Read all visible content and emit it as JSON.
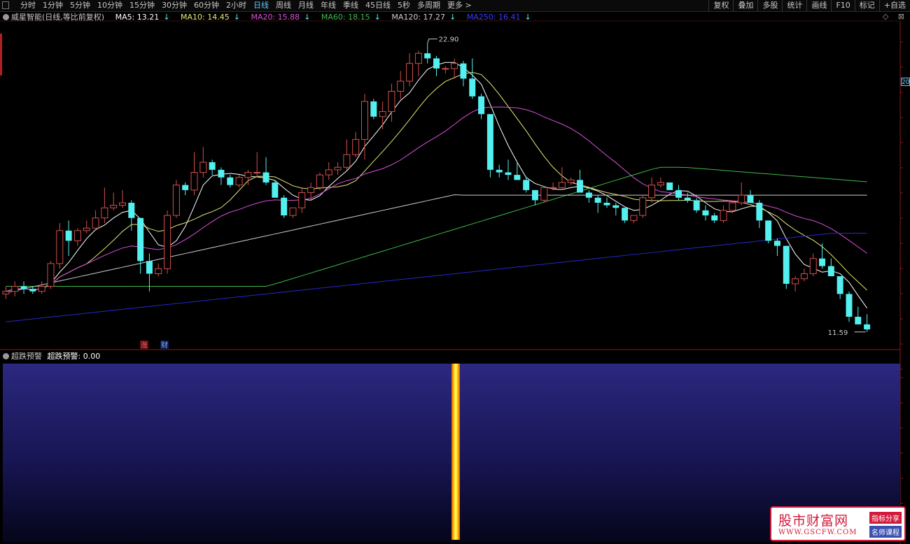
{
  "toolbar": {
    "periods": [
      "分时",
      "1分钟",
      "5分钟",
      "10分钟",
      "15分钟",
      "30分钟",
      "60分钟",
      "2小时",
      "日线",
      "周线",
      "月线",
      "年线",
      "季线",
      "45日线",
      "5秒",
      "多周期",
      "更多 >"
    ],
    "active_index": 8,
    "right_tools": [
      "复权",
      "叠加",
      "多股",
      "统计",
      "画线",
      "F10",
      "标记",
      "+自选"
    ]
  },
  "legend": {
    "stock": "威星智能(日线,等比前复权)",
    "ma5": "MA5: 13.21",
    "ma10": "MA10: 14.45",
    "ma20": "MA20: 15.88",
    "ma60": "MA60: 18.15",
    "ma120": "MA120: 17.27",
    "ma250": "MA250: 16.41",
    "arrow": "↓"
  },
  "tr_icons": [
    "diamond-icon",
    "close-icon"
  ],
  "axis_tag": "20",
  "chart": {
    "high_label": "22.90",
    "low_label": "11.59",
    "markers": [
      "涨",
      "财"
    ]
  },
  "sub": {
    "title": "超跌预警",
    "value": "超跌预警: 0.00"
  },
  "watermark": {
    "name": "股市财富网",
    "url": "WWW.GSCFW.COM",
    "tag1": "指标分享",
    "tag2": "名师课程"
  },
  "colors": {
    "up": "#d2504b",
    "down": "#54f0f0",
    "ma5": "#ffffff",
    "ma10": "#e6e675",
    "ma20": "#d94fd9",
    "ma60": "#3fb84a",
    "ma120": "#cccccc",
    "ma250": "#2727c8"
  },
  "chart_data": {
    "type": "candlestick",
    "price_range": [
      11.3,
      23.5
    ],
    "candles": [
      [
        13.0,
        13.3,
        12.8,
        13.1
      ],
      [
        13.1,
        13.5,
        12.9,
        13.3
      ],
      [
        13.3,
        13.5,
        13.0,
        13.2
      ],
      [
        13.2,
        13.3,
        13.0,
        13.1
      ],
      [
        13.1,
        13.5,
        13.0,
        13.3
      ],
      [
        13.3,
        14.3,
        13.2,
        14.2
      ],
      [
        14.2,
        15.8,
        14.0,
        15.5
      ],
      [
        15.5,
        15.9,
        14.5,
        15.1
      ],
      [
        15.1,
        15.6,
        14.9,
        15.5
      ],
      [
        15.5,
        15.9,
        15.4,
        15.6
      ],
      [
        15.6,
        16.3,
        15.6,
        16.0
      ],
      [
        16.0,
        17.2,
        15.8,
        16.4
      ],
      [
        16.4,
        17.0,
        16.3,
        16.5
      ],
      [
        16.5,
        17.1,
        16.4,
        16.6
      ],
      [
        16.6,
        16.7,
        15.5,
        16.0
      ],
      [
        16.0,
        16.0,
        13.8,
        14.3
      ],
      [
        14.3,
        14.6,
        13.1,
        13.8
      ],
      [
        13.8,
        14.2,
        13.7,
        14.0
      ],
      [
        14.0,
        16.3,
        13.8,
        16.1
      ],
      [
        16.1,
        17.5,
        16.0,
        17.3
      ],
      [
        17.3,
        17.4,
        16.9,
        17.1
      ],
      [
        17.1,
        18.6,
        16.9,
        17.8
      ],
      [
        17.8,
        18.8,
        17.6,
        18.2
      ],
      [
        18.2,
        18.3,
        17.7,
        17.9
      ],
      [
        17.9,
        18.0,
        17.3,
        17.6
      ],
      [
        17.6,
        17.7,
        17.2,
        17.3
      ],
      [
        17.3,
        17.7,
        17.2,
        17.6
      ],
      [
        17.6,
        17.9,
        17.3,
        17.8
      ],
      [
        17.8,
        18.6,
        17.6,
        17.8
      ],
      [
        17.8,
        18.4,
        17.3,
        17.4
      ],
      [
        17.4,
        17.5,
        16.8,
        16.8
      ],
      [
        16.8,
        16.9,
        16.0,
        16.1
      ],
      [
        16.1,
        16.4,
        16.0,
        16.4
      ],
      [
        16.4,
        17.2,
        16.2,
        17.0
      ],
      [
        17.0,
        17.4,
        16.7,
        17.2
      ],
      [
        17.2,
        17.8,
        17.1,
        17.7
      ],
      [
        17.7,
        18.2,
        17.5,
        17.9
      ],
      [
        17.9,
        18.2,
        17.7,
        18.0
      ],
      [
        18.0,
        19.1,
        17.9,
        18.5
      ],
      [
        18.5,
        19.4,
        18.4,
        19.1
      ],
      [
        19.1,
        20.9,
        18.3,
        20.6
      ],
      [
        20.6,
        20.7,
        19.9,
        20.0
      ],
      [
        20.0,
        20.6,
        19.5,
        20.2
      ],
      [
        20.2,
        21.3,
        19.8,
        21.0
      ],
      [
        21.0,
        21.8,
        20.7,
        21.4
      ],
      [
        21.4,
        22.5,
        21.2,
        22.1
      ],
      [
        22.1,
        22.6,
        21.6,
        22.5
      ],
      [
        22.5,
        22.9,
        22.1,
        22.3
      ],
      [
        22.3,
        22.4,
        21.6,
        21.9
      ],
      [
        21.9,
        22.0,
        21.7,
        21.9
      ],
      [
        21.9,
        22.3,
        21.5,
        22.1
      ],
      [
        22.1,
        22.2,
        21.2,
        21.5
      ],
      [
        21.5,
        22.3,
        20.7,
        20.8
      ],
      [
        20.8,
        20.9,
        19.9,
        20.1
      ],
      [
        20.1,
        20.1,
        17.6,
        17.9
      ],
      [
        17.9,
        18.1,
        17.6,
        17.8
      ],
      [
        17.8,
        18.3,
        17.5,
        17.7
      ],
      [
        17.7,
        18.2,
        17.5,
        17.5
      ],
      [
        17.5,
        17.6,
        17.0,
        17.1
      ],
      [
        17.1,
        17.1,
        16.5,
        16.7
      ],
      [
        16.7,
        17.2,
        16.6,
        17.2
      ],
      [
        17.2,
        17.4,
        17.1,
        17.2
      ],
      [
        17.2,
        18.0,
        17.1,
        17.4
      ],
      [
        17.4,
        17.6,
        17.3,
        17.5
      ],
      [
        17.5,
        17.9,
        17.1,
        17.0
      ],
      [
        17.0,
        17.1,
        16.6,
        16.8
      ],
      [
        16.8,
        16.9,
        16.2,
        16.6
      ],
      [
        16.6,
        16.8,
        16.4,
        16.5
      ],
      [
        16.5,
        16.6,
        16.1,
        16.4
      ],
      [
        16.4,
        16.4,
        15.8,
        15.9
      ],
      [
        15.9,
        16.1,
        15.8,
        16.1
      ],
      [
        16.1,
        16.9,
        16.0,
        16.8
      ],
      [
        16.8,
        17.6,
        16.6,
        17.3
      ],
      [
        17.3,
        17.6,
        17.2,
        17.4
      ],
      [
        17.4,
        17.4,
        17.1,
        17.1
      ],
      [
        17.1,
        17.3,
        16.7,
        16.8
      ],
      [
        16.8,
        17.0,
        16.6,
        16.7
      ],
      [
        16.7,
        16.8,
        16.2,
        16.3
      ],
      [
        16.3,
        16.5,
        15.9,
        16.1
      ],
      [
        16.1,
        16.2,
        15.8,
        15.9
      ],
      [
        15.9,
        16.5,
        15.8,
        16.3
      ],
      [
        16.3,
        16.7,
        16.2,
        16.6
      ],
      [
        16.6,
        17.4,
        16.5,
        16.9
      ],
      [
        16.9,
        17.1,
        16.6,
        16.6
      ],
      [
        16.6,
        16.7,
        15.6,
        15.9
      ],
      [
        15.9,
        15.9,
        15.0,
        15.1
      ],
      [
        15.1,
        15.2,
        14.5,
        14.9
      ],
      [
        14.9,
        14.9,
        13.2,
        13.4
      ],
      [
        13.4,
        13.7,
        13.1,
        13.6
      ],
      [
        13.6,
        14.0,
        13.5,
        13.8
      ],
      [
        13.8,
        14.6,
        13.7,
        14.4
      ],
      [
        14.4,
        15.0,
        14.0,
        14.1
      ],
      [
        14.1,
        14.4,
        13.7,
        13.7
      ],
      [
        13.7,
        13.7,
        12.8,
        13.0
      ],
      [
        13.0,
        13.1,
        11.9,
        12.1
      ],
      [
        12.1,
        12.5,
        11.8,
        11.8
      ],
      [
        11.8,
        12.2,
        11.5,
        11.6
      ]
    ]
  }
}
